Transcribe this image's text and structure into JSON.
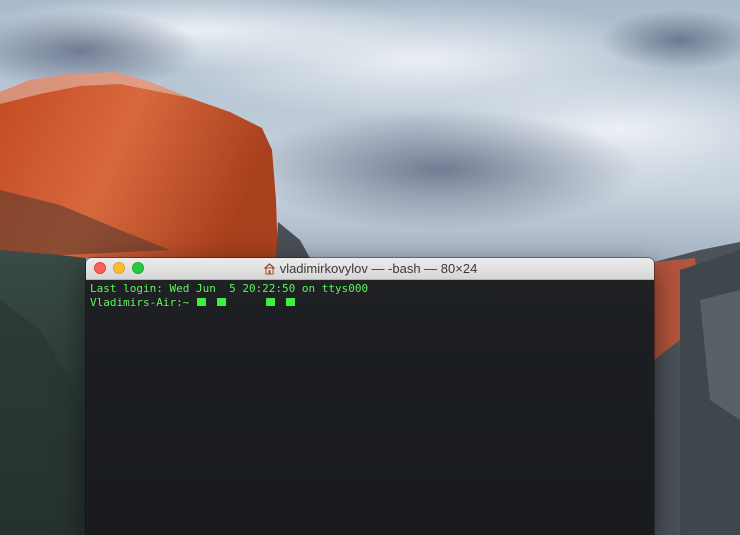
{
  "window": {
    "title": "vladimirkovylov — -bash — 80×24"
  },
  "terminal": {
    "lines": [
      "Last login: Wed Jun  5 20:22:50 on ttys000"
    ],
    "prompt": "Vladimirs-Air:~"
  },
  "icons": {
    "window_title": "home-icon",
    "controls": [
      "close-icon",
      "minimize-icon",
      "zoom-icon"
    ]
  },
  "colors": {
    "terminal_text": "#5ef55e",
    "close": "#fc5f57",
    "minimize": "#fdbc2e",
    "zoom": "#28c840"
  }
}
